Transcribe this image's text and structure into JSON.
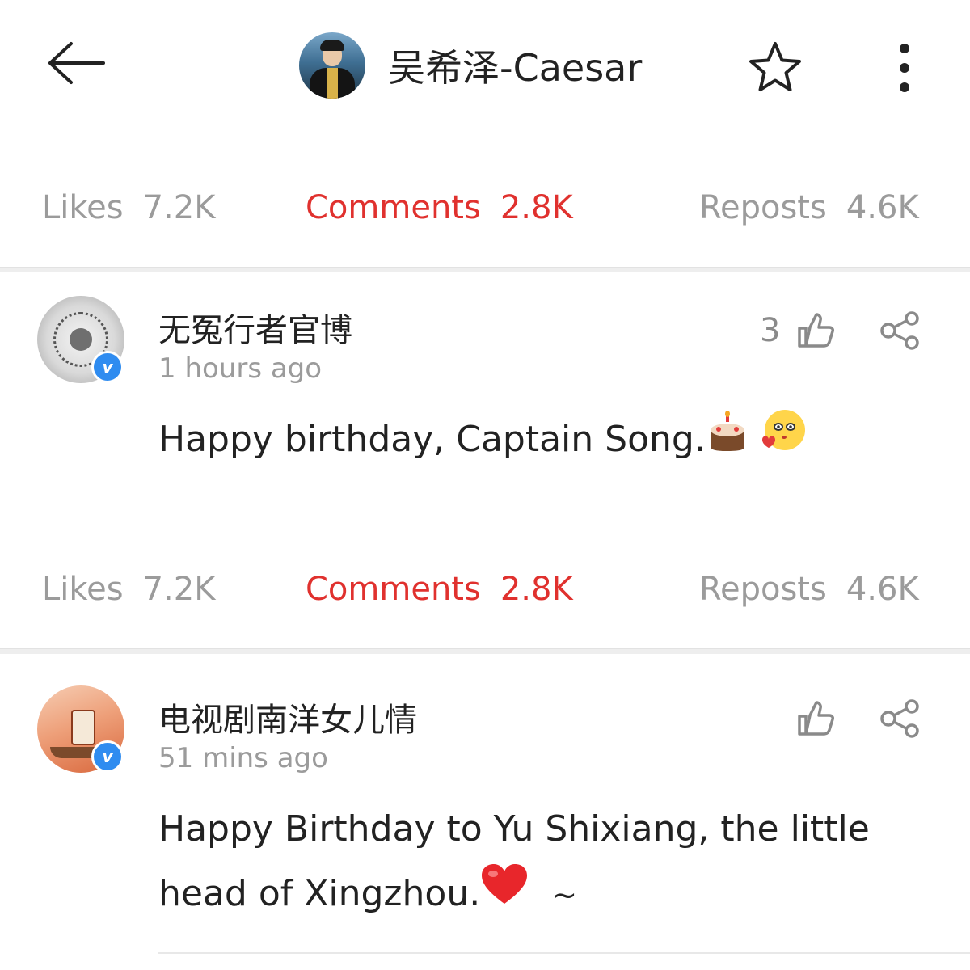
{
  "header": {
    "title": "吴希泽-Caesar",
    "back_icon": "arrow-left-icon",
    "star_icon": "star-outline-icon",
    "more_icon": "more-vertical-icon"
  },
  "stats_bar": {
    "likes_label": "Likes",
    "likes_value": "7.2K",
    "comments_label": "Comments",
    "comments_value": "2.8K",
    "reposts_label": "Reposts",
    "reposts_value": "4.6K",
    "active_tab": "comments"
  },
  "comments": [
    {
      "username": "无冤行者官博",
      "verified": true,
      "time": "1 hours ago",
      "like_count": "3",
      "text": "Happy birthday, Captain Song.",
      "emojis": [
        "birthday-cake-icon",
        "blushing-face-icon"
      ]
    },
    {
      "username": "电视剧南洋女儿情",
      "verified": true,
      "time": "51  mins ago",
      "like_count": "",
      "text_line1": "Happy Birthday to Yu Shixiang, the little",
      "text_line2": "head of Xingzhou.",
      "tilde": "~",
      "emojis": [
        "red-heart-icon"
      ]
    }
  ],
  "colors": {
    "accent": "#e0312e",
    "muted": "#9b9b9b",
    "verified_badge": "#2f8cf0",
    "text": "#222222"
  }
}
